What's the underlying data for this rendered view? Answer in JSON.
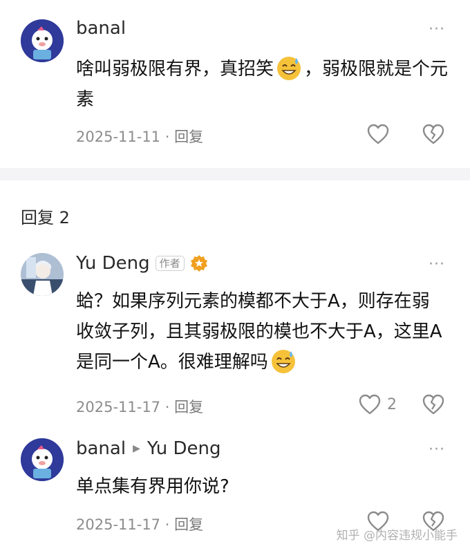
{
  "comment1": {
    "username": "banal",
    "text_before_emoji": "啥叫弱极限有界，真招笑",
    "emoji": "sweat-smile-emoji",
    "text_after_emoji": "，弱极限就是个元素",
    "date": "2025-11-11",
    "separator": "·",
    "reply_label": "回复"
  },
  "section": {
    "title": "回复 2"
  },
  "reply1": {
    "username": "Yu Deng",
    "author_tag": "作者",
    "text": "蛤？如果序列元素的模都不大于A，则存在弱收敛子列，且其弱极限的模也不大于A，这里A是同一个A。很难理解吗",
    "emoji": "sweat-smile-emoji",
    "date": "2025-11-17",
    "separator": "·",
    "reply_label": "回复",
    "like_count": "2"
  },
  "reply2": {
    "username": "banal",
    "reply_to": "Yu Deng",
    "text": "单点集有界用你说?",
    "date": "2025-11-17",
    "separator": "·",
    "reply_label": "回复"
  },
  "more_label": "···",
  "watermark": "知乎 @内容违规小能手",
  "colors": {
    "text": "#121212",
    "meta": "#8c8c8c",
    "divider": "#f4f4f6",
    "badge": "#f0a020"
  }
}
